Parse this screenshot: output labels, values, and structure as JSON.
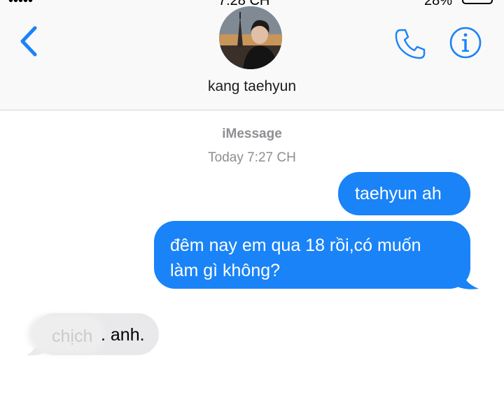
{
  "status_bar": {
    "carrier": "•••••",
    "time": "7:28 CH",
    "battery": "28%"
  },
  "header": {
    "contact_name": "kang taehyun",
    "back_icon": "chevron-left-icon",
    "phone_icon": "phone-icon",
    "info_icon": "info-icon",
    "accent_color": "#1a83f7"
  },
  "conversation": {
    "service_label": "iMessage",
    "timestamp": "Today 7:27 CH",
    "outgoing": [
      {
        "text": "taehyun ah"
      },
      {
        "line1": "đêm nay em qua 18 rồi,có muốn",
        "line2": "làm gì không?"
      }
    ],
    "incoming": [
      {
        "obscured_text": "chịch",
        "visible_text": ". anh."
      }
    ]
  },
  "colors": {
    "outgoing_bubble": "#1a83f7",
    "incoming_bubble": "#e9e9eb",
    "meta_text": "#8e8e93"
  }
}
